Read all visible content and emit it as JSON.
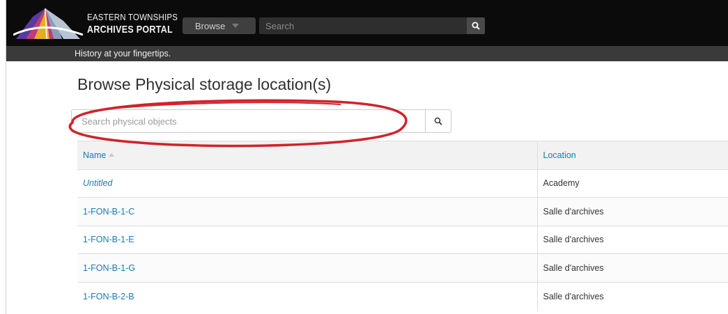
{
  "header": {
    "brand_line1": "EASTERN TOWNSHIPS",
    "brand_line2": "ARCHIVES PORTAL",
    "browse_label": "Browse",
    "search_placeholder": "Search",
    "tagline": "History at your fingertips."
  },
  "page": {
    "title": "Browse Physical storage location(s)",
    "search_placeholder": "Search physical objects"
  },
  "table": {
    "columns": [
      "Name",
      "Location"
    ],
    "rows": [
      {
        "name": "Untitled",
        "location": "Academy"
      },
      {
        "name": "1-FON-B-1-C",
        "location": "Salle d'archives"
      },
      {
        "name": "1-FON-B-1-E",
        "location": "Salle d'archives"
      },
      {
        "name": "1-FON-B-1-G",
        "location": "Salle d'archives"
      },
      {
        "name": "1-FON-B-2-B",
        "location": "Salle d'archives"
      }
    ]
  },
  "colors": {
    "header_bg": "#0b0b0b",
    "tagline_bg": "#3a3a3a",
    "link": "#1a7ab0",
    "annotation": "#d0232a"
  },
  "icons": [
    "logo-icon",
    "caret-down-icon",
    "search-icon",
    "sort-up-icon"
  ]
}
